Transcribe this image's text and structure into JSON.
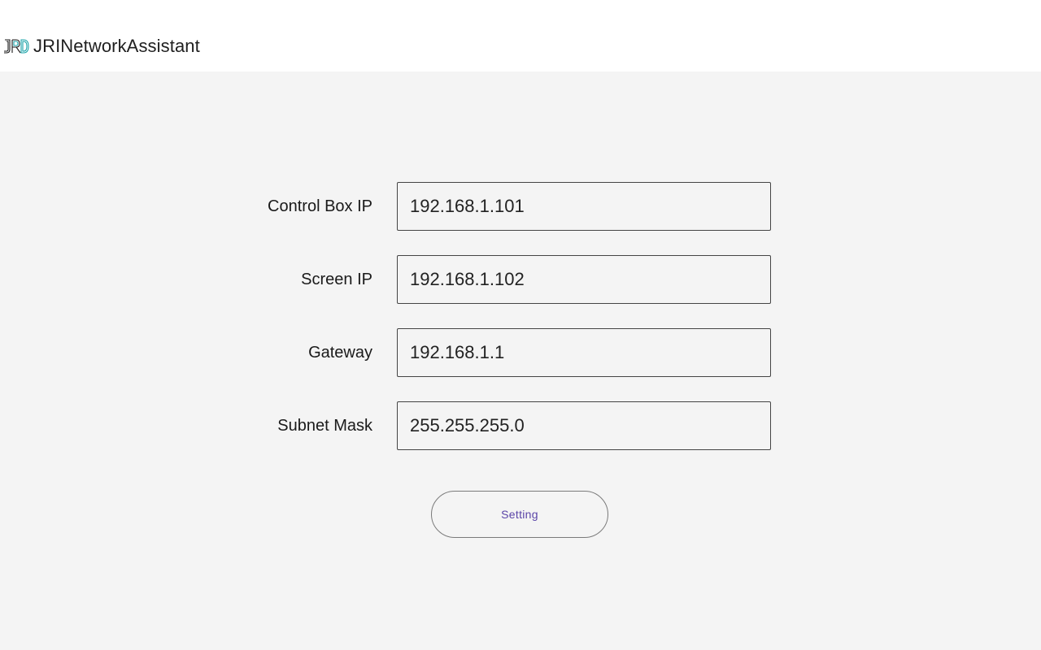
{
  "app": {
    "title": "JRINetworkAssistant",
    "logo_icon": "jri-logo-icon",
    "logo_color": "#1aa3a8"
  },
  "form": {
    "fields": [
      {
        "label": "Control Box IP",
        "value": "192.168.1.101"
      },
      {
        "label": "Screen IP",
        "value": "192.168.1.102"
      },
      {
        "label": "Gateway",
        "value": "192.168.1.1"
      },
      {
        "label": "Subnet Mask",
        "value": "255.255.255.0"
      }
    ],
    "submit_label": "Setting",
    "submit_color": "#5b45a8"
  }
}
